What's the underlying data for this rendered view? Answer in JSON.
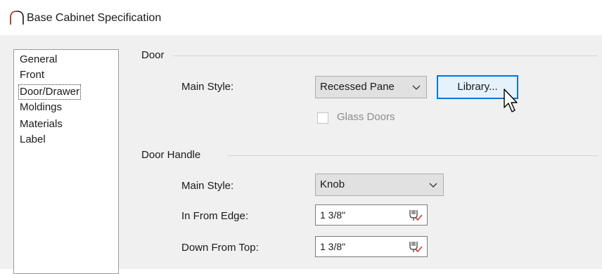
{
  "window": {
    "title": "Base Cabinet Specification"
  },
  "sidebar": {
    "items": [
      {
        "label": "General"
      },
      {
        "label": "Front"
      },
      {
        "label": "Door/Drawer"
      },
      {
        "label": "Moldings"
      },
      {
        "label": "Materials"
      },
      {
        "label": "Label"
      }
    ],
    "selected": "Door/Drawer"
  },
  "door": {
    "group_label": "Door",
    "main_style_label": "Main Style:",
    "main_style_value": "Recessed Pane",
    "library_button": "Library...",
    "glass_doors_label": "Glass Doors",
    "glass_doors_checked": false
  },
  "door_handle": {
    "group_label": "Door Handle",
    "main_style_label": "Main Style:",
    "main_style_value": "Knob",
    "in_from_edge_label": "In From Edge:",
    "in_from_edge_value": "1 3/8\"",
    "down_from_top_label": "Down From Top:",
    "down_from_top_value": "1 3/8\""
  },
  "icons": {
    "title": "cabinet-arch-icon",
    "dropdown": "chevron-down-icon",
    "field": "edit-value-icon",
    "cursor": "mouse-pointer-icon"
  },
  "colors": {
    "accent": "#0078d7",
    "title_icon": "#c0392b",
    "field_icon_check": "#d9342b"
  }
}
